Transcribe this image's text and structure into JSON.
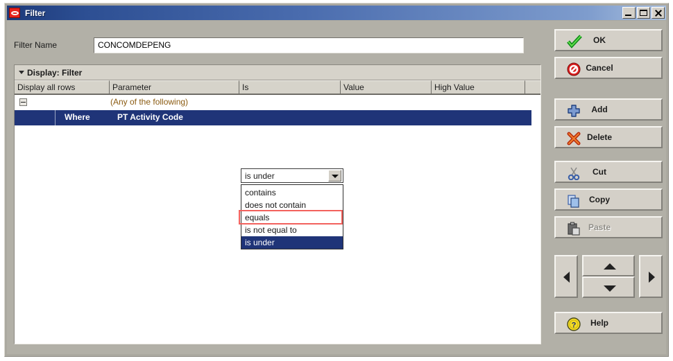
{
  "window": {
    "title": "Filter",
    "app_icon": "oracle-oval-icon",
    "controls": {
      "minimize": "minimize-icon",
      "maximize": "maximize-icon",
      "close": "close-icon"
    },
    "titlebar_color": "#2d4f93"
  },
  "form": {
    "filter_name_label": "Filter Name",
    "filter_name_value": "CONCOMDEPENG",
    "filter_name_placeholder": ""
  },
  "display_bar": {
    "label": "Display: Filter",
    "chevron": "chevron-down-icon"
  },
  "grid": {
    "columns": [
      "Display all rows",
      "Parameter",
      "Is",
      "Value",
      "High Value",
      ""
    ],
    "rows": [
      {
        "type": "group",
        "expander": "collapse-minus-icon",
        "label": "(Any of the following)"
      },
      {
        "type": "condition",
        "selected": true,
        "where": "Where",
        "parameter": "PT Activity Code",
        "is": "is under",
        "value": "",
        "high_value": ""
      }
    ]
  },
  "combobox": {
    "value": "is under",
    "arrow": "chevron-down-icon",
    "open": true,
    "options": [
      {
        "label": "contains",
        "selected": false,
        "annotated": false
      },
      {
        "label": "does not contain",
        "selected": false,
        "annotated": false
      },
      {
        "label": "equals",
        "selected": false,
        "annotated": true
      },
      {
        "label": "is not equal to",
        "selected": false,
        "annotated": false
      },
      {
        "label": "is under",
        "selected": true,
        "annotated": false
      }
    ],
    "annotation_color": "#f2615c",
    "selection_color": "#1f3478"
  },
  "buttons": [
    {
      "label": "OK",
      "icon": "green-check-icon",
      "disabled": false
    },
    {
      "label": "Cancel",
      "icon": "red-prohibition-icon",
      "disabled": false
    },
    {
      "label": "Add",
      "icon": "blue-plus-icon",
      "disabled": false
    },
    {
      "label": "Delete",
      "icon": "red-x-icon",
      "disabled": false
    },
    {
      "label": "Cut",
      "icon": "scissors-icon",
      "disabled": false
    },
    {
      "label": "Copy",
      "icon": "copy-pages-icon",
      "disabled": false
    },
    {
      "label": "Paste",
      "icon": "clipboard-icon",
      "disabled": true
    },
    {
      "label": "Help",
      "icon": "yellow-question-icon",
      "disabled": false
    }
  ],
  "nav": {
    "left": "arrow-left-icon",
    "up": "arrow-up-icon",
    "down": "arrow-down-icon",
    "right": "arrow-right-icon"
  }
}
